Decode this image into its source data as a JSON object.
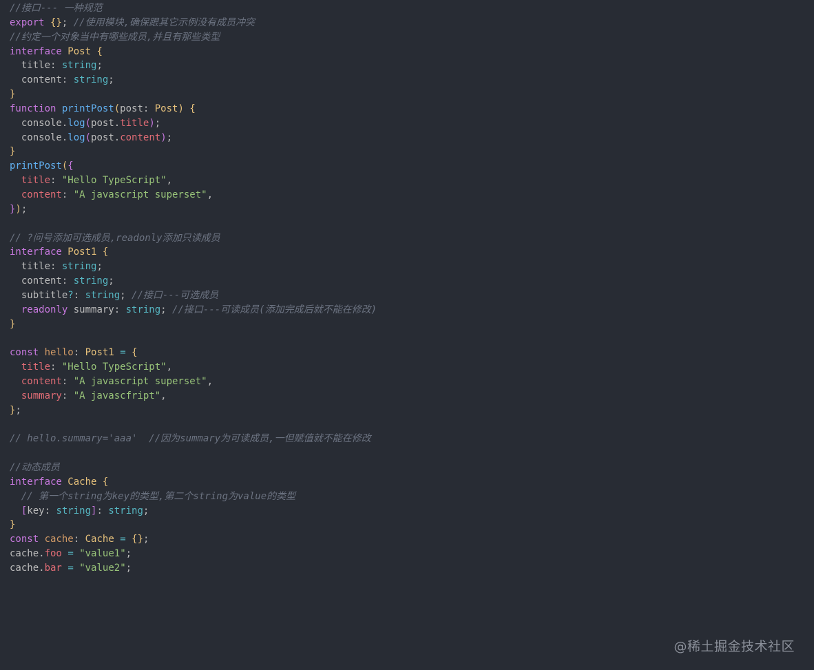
{
  "colors": {
    "background": "#282c34",
    "comment": "#6b7280",
    "keyword": "#c678dd",
    "type": "#e5c07b",
    "function": "#61afef",
    "string": "#98c379",
    "property": "#e06c75",
    "builtin": "#56b6c2",
    "plain": "#bbbbbb"
  },
  "editor": {
    "lines": [
      [
        {
          "t": "//接口--- 一种规范",
          "c": "tok-comment"
        }
      ],
      [
        {
          "t": "export",
          "c": "tok-keyword"
        },
        {
          "t": " ",
          "c": "tok-punct"
        },
        {
          "t": "{}",
          "c": "tok-brace"
        },
        {
          "t": "; ",
          "c": "tok-punct"
        },
        {
          "t": "//使用模块,确保跟其它示例没有成员冲突",
          "c": "tok-comment"
        }
      ],
      [
        {
          "t": "//约定一个对象当中有哪些成员,并且有那些类型",
          "c": "tok-comment"
        }
      ],
      [
        {
          "t": "interface",
          "c": "tok-keyword"
        },
        {
          "t": " ",
          "c": "tok-punct"
        },
        {
          "t": "Post",
          "c": "tok-type"
        },
        {
          "t": " ",
          "c": "tok-punct"
        },
        {
          "t": "{",
          "c": "tok-brace"
        }
      ],
      [
        {
          "t": "  title",
          "c": "tok-punct"
        },
        {
          "t": ": ",
          "c": "tok-punct"
        },
        {
          "t": "string",
          "c": "tok-builtin"
        },
        {
          "t": ";",
          "c": "tok-punct"
        }
      ],
      [
        {
          "t": "  content",
          "c": "tok-punct"
        },
        {
          "t": ": ",
          "c": "tok-punct"
        },
        {
          "t": "string",
          "c": "tok-builtin"
        },
        {
          "t": ";",
          "c": "tok-punct"
        }
      ],
      [
        {
          "t": "}",
          "c": "tok-brace"
        }
      ],
      [
        {
          "t": "function",
          "c": "tok-keyword"
        },
        {
          "t": " ",
          "c": "tok-punct"
        },
        {
          "t": "printPost",
          "c": "tok-func"
        },
        {
          "t": "(",
          "c": "tok-brace"
        },
        {
          "t": "post",
          "c": "tok-punct"
        },
        {
          "t": ": ",
          "c": "tok-punct"
        },
        {
          "t": "Post",
          "c": "tok-type"
        },
        {
          "t": ")",
          "c": "tok-brace"
        },
        {
          "t": " ",
          "c": "tok-punct"
        },
        {
          "t": "{",
          "c": "tok-brace"
        }
      ],
      [
        {
          "t": "  console.",
          "c": "tok-punct"
        },
        {
          "t": "log",
          "c": "tok-func"
        },
        {
          "t": "(",
          "c": "tok-brace2"
        },
        {
          "t": "post.",
          "c": "tok-punct"
        },
        {
          "t": "title",
          "c": "tok-prop"
        },
        {
          "t": ")",
          "c": "tok-brace2"
        },
        {
          "t": ";",
          "c": "tok-punct"
        }
      ],
      [
        {
          "t": "  console.",
          "c": "tok-punct"
        },
        {
          "t": "log",
          "c": "tok-func"
        },
        {
          "t": "(",
          "c": "tok-brace2"
        },
        {
          "t": "post.",
          "c": "tok-punct"
        },
        {
          "t": "content",
          "c": "tok-prop"
        },
        {
          "t": ")",
          "c": "tok-brace2"
        },
        {
          "t": ";",
          "c": "tok-punct"
        }
      ],
      [
        {
          "t": "}",
          "c": "tok-brace"
        }
      ],
      [
        {
          "t": "printPost",
          "c": "tok-func"
        },
        {
          "t": "(",
          "c": "tok-brace"
        },
        {
          "t": "{",
          "c": "tok-brace2"
        }
      ],
      [
        {
          "t": "  title",
          "c": "tok-prop"
        },
        {
          "t": ": ",
          "c": "tok-punct"
        },
        {
          "t": "\"Hello TypeScript\"",
          "c": "tok-string"
        },
        {
          "t": ",",
          "c": "tok-punct"
        }
      ],
      [
        {
          "t": "  content",
          "c": "tok-prop"
        },
        {
          "t": ": ",
          "c": "tok-punct"
        },
        {
          "t": "\"A javascript superset\"",
          "c": "tok-string"
        },
        {
          "t": ",",
          "c": "tok-punct"
        }
      ],
      [
        {
          "t": "}",
          "c": "tok-brace2"
        },
        {
          "t": ")",
          "c": "tok-brace"
        },
        {
          "t": ";",
          "c": "tok-punct"
        }
      ],
      [
        {
          "t": "",
          "c": "tok-punct"
        }
      ],
      [
        {
          "t": "// ?问号添加可选成员,readonly添加只读成员",
          "c": "tok-comment"
        }
      ],
      [
        {
          "t": "interface",
          "c": "tok-keyword"
        },
        {
          "t": " ",
          "c": "tok-punct"
        },
        {
          "t": "Post1",
          "c": "tok-type"
        },
        {
          "t": " ",
          "c": "tok-punct"
        },
        {
          "t": "{",
          "c": "tok-brace"
        }
      ],
      [
        {
          "t": "  title",
          "c": "tok-punct"
        },
        {
          "t": ": ",
          "c": "tok-punct"
        },
        {
          "t": "string",
          "c": "tok-builtin"
        },
        {
          "t": ";",
          "c": "tok-punct"
        }
      ],
      [
        {
          "t": "  content",
          "c": "tok-punct"
        },
        {
          "t": ": ",
          "c": "tok-punct"
        },
        {
          "t": "string",
          "c": "tok-builtin"
        },
        {
          "t": ";",
          "c": "tok-punct"
        }
      ],
      [
        {
          "t": "  subtitle",
          "c": "tok-punct"
        },
        {
          "t": "?",
          "c": "tok-op"
        },
        {
          "t": ": ",
          "c": "tok-punct"
        },
        {
          "t": "string",
          "c": "tok-builtin"
        },
        {
          "t": "; ",
          "c": "tok-punct"
        },
        {
          "t": "//接口---可选成员",
          "c": "tok-comment"
        }
      ],
      [
        {
          "t": "  readonly",
          "c": "tok-keyword"
        },
        {
          "t": " summary",
          "c": "tok-punct"
        },
        {
          "t": ": ",
          "c": "tok-punct"
        },
        {
          "t": "string",
          "c": "tok-builtin"
        },
        {
          "t": "; ",
          "c": "tok-punct"
        },
        {
          "t": "//接口---可读成员(添加完成后就不能在修改)",
          "c": "tok-comment"
        }
      ],
      [
        {
          "t": "}",
          "c": "tok-brace"
        }
      ],
      [
        {
          "t": "",
          "c": "tok-punct"
        }
      ],
      [
        {
          "t": "const",
          "c": "tok-keyword"
        },
        {
          "t": " ",
          "c": "tok-punct"
        },
        {
          "t": "hello",
          "c": "tok-var"
        },
        {
          "t": ": ",
          "c": "tok-punct"
        },
        {
          "t": "Post1",
          "c": "tok-type"
        },
        {
          "t": " ",
          "c": "tok-punct"
        },
        {
          "t": "=",
          "c": "tok-op"
        },
        {
          "t": " ",
          "c": "tok-punct"
        },
        {
          "t": "{",
          "c": "tok-brace"
        }
      ],
      [
        {
          "t": "  title",
          "c": "tok-prop"
        },
        {
          "t": ": ",
          "c": "tok-punct"
        },
        {
          "t": "\"Hello TypeScript\"",
          "c": "tok-string"
        },
        {
          "t": ",",
          "c": "tok-punct"
        }
      ],
      [
        {
          "t": "  content",
          "c": "tok-prop"
        },
        {
          "t": ": ",
          "c": "tok-punct"
        },
        {
          "t": "\"A javascript superset\"",
          "c": "tok-string"
        },
        {
          "t": ",",
          "c": "tok-punct"
        }
      ],
      [
        {
          "t": "  summary",
          "c": "tok-prop"
        },
        {
          "t": ": ",
          "c": "tok-punct"
        },
        {
          "t": "\"A javascfript\"",
          "c": "tok-string"
        },
        {
          "t": ",",
          "c": "tok-punct"
        }
      ],
      [
        {
          "t": "}",
          "c": "tok-brace"
        },
        {
          "t": ";",
          "c": "tok-punct"
        }
      ],
      [
        {
          "t": "",
          "c": "tok-punct"
        }
      ],
      [
        {
          "t": "// hello.summary='aaa'  //因为summary为可读成员,一但赋值就不能在修改",
          "c": "tok-comment"
        }
      ],
      [
        {
          "t": "",
          "c": "tok-punct"
        }
      ],
      [
        {
          "t": "//动态成员",
          "c": "tok-comment"
        }
      ],
      [
        {
          "t": "interface",
          "c": "tok-keyword"
        },
        {
          "t": " ",
          "c": "tok-punct"
        },
        {
          "t": "Cache",
          "c": "tok-type"
        },
        {
          "t": " ",
          "c": "tok-punct"
        },
        {
          "t": "{",
          "c": "tok-brace"
        }
      ],
      [
        {
          "t": "  ",
          "c": "tok-punct"
        },
        {
          "t": "// 第一个string为key的类型,第二个string为value的类型",
          "c": "tok-comment"
        }
      ],
      [
        {
          "t": "  ",
          "c": "tok-punct"
        },
        {
          "t": "[",
          "c": "tok-brace2"
        },
        {
          "t": "key",
          "c": "tok-punct"
        },
        {
          "t": ": ",
          "c": "tok-punct"
        },
        {
          "t": "string",
          "c": "tok-builtin"
        },
        {
          "t": "]",
          "c": "tok-brace2"
        },
        {
          "t": ": ",
          "c": "tok-punct"
        },
        {
          "t": "string",
          "c": "tok-builtin"
        },
        {
          "t": ";",
          "c": "tok-punct"
        }
      ],
      [
        {
          "t": "}",
          "c": "tok-brace"
        }
      ],
      [
        {
          "t": "const",
          "c": "tok-keyword"
        },
        {
          "t": " ",
          "c": "tok-punct"
        },
        {
          "t": "cache",
          "c": "tok-var"
        },
        {
          "t": ": ",
          "c": "tok-punct"
        },
        {
          "t": "Cache",
          "c": "tok-type"
        },
        {
          "t": " ",
          "c": "tok-punct"
        },
        {
          "t": "=",
          "c": "tok-op"
        },
        {
          "t": " ",
          "c": "tok-punct"
        },
        {
          "t": "{}",
          "c": "tok-brace"
        },
        {
          "t": ";",
          "c": "tok-punct"
        }
      ],
      [
        {
          "t": "cache.",
          "c": "tok-punct"
        },
        {
          "t": "foo",
          "c": "tok-prop"
        },
        {
          "t": " ",
          "c": "tok-punct"
        },
        {
          "t": "=",
          "c": "tok-op"
        },
        {
          "t": " ",
          "c": "tok-punct"
        },
        {
          "t": "\"value1\"",
          "c": "tok-string"
        },
        {
          "t": ";",
          "c": "tok-punct"
        }
      ],
      [
        {
          "t": "cache.",
          "c": "tok-punct"
        },
        {
          "t": "bar",
          "c": "tok-prop"
        },
        {
          "t": " ",
          "c": "tok-punct"
        },
        {
          "t": "=",
          "c": "tok-op"
        },
        {
          "t": " ",
          "c": "tok-punct"
        },
        {
          "t": "\"value2\"",
          "c": "tok-string"
        },
        {
          "t": ";",
          "c": "tok-punct"
        }
      ]
    ]
  },
  "watermark": {
    "text": "@稀土掘金技术社区"
  }
}
